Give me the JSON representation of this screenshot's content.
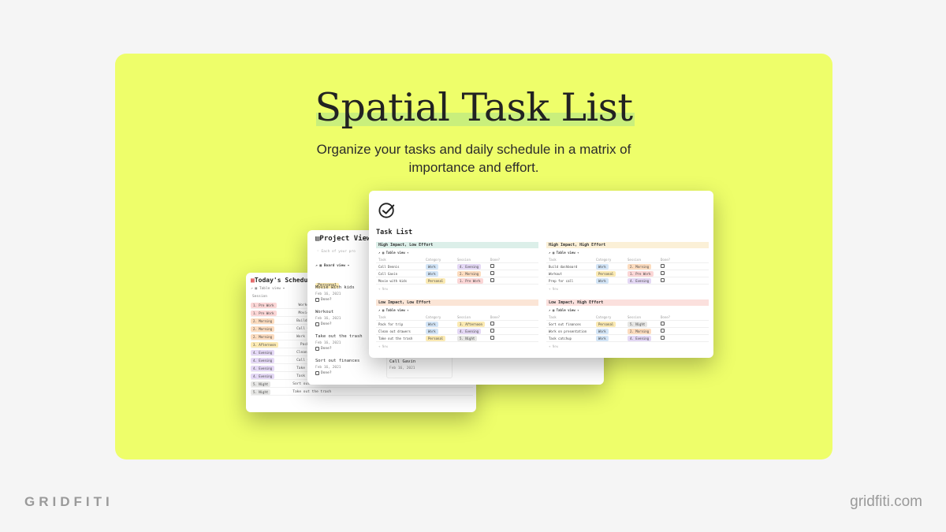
{
  "hero": {
    "title": "Spatial Task List",
    "subtitle": "Organize your tasks and daily schedule in a matrix of importance and effort."
  },
  "schedule_card": {
    "title": "Today's Schedule",
    "view": "Table view",
    "col_session": "Session",
    "rows": [
      {
        "session": "1. Pre Work",
        "color": "red",
        "task": "Workout"
      },
      {
        "session": "1. Pre Work",
        "color": "red",
        "task": "Movie with kids"
      },
      {
        "session": "2. Morning",
        "color": "orange",
        "task": "Build dashboard"
      },
      {
        "session": "2. Morning",
        "color": "orange",
        "task": "Call Gavin"
      },
      {
        "session": "2. Morning",
        "color": "orange",
        "task": "Work on presentation"
      },
      {
        "session": "3. Afternoon",
        "color": "yellow",
        "task": "Pack for trip"
      },
      {
        "session": "4. Evening",
        "color": "purple",
        "task": "Clean out drawers"
      },
      {
        "session": "4. Evening",
        "color": "purple",
        "task": "Call Gavin"
      },
      {
        "session": "4. Evening",
        "color": "purple",
        "task": "Take out the trash"
      },
      {
        "session": "4. Evening",
        "color": "purple",
        "task": "Task catchup"
      },
      {
        "session": "5. Night",
        "color": "gray",
        "task": "Sort out finances"
      },
      {
        "session": "5. Night",
        "color": "gray",
        "task": "Take out the trash"
      }
    ]
  },
  "project_card": {
    "title": "Project View",
    "subtitle": "Each of your pro",
    "view": "Board view",
    "group": "Personal",
    "items": [
      {
        "name": "Movie with kids",
        "date": "Feb 16, 2021",
        "done": "Done?"
      },
      {
        "name": "Workout",
        "date": "Feb 16, 2021",
        "done": "Done?"
      },
      {
        "name": "Take out the trash",
        "date": "Feb 16, 2021",
        "done": "Done?"
      },
      {
        "name": "Sort out finances",
        "date": "Feb 16, 2021",
        "done": "Done?"
      }
    ],
    "side_item": {
      "name": "Call Gavin",
      "date": "Feb 16, 2021"
    }
  },
  "task_card": {
    "title": "Task List",
    "columns": [
      "Task",
      "Category",
      "Session",
      "Done?"
    ],
    "view": "Table view",
    "new_label": "+ New",
    "quadrants": [
      {
        "title": "High Impact, Low Effort",
        "rows": [
          {
            "task": "Call Dennis",
            "category": "Work",
            "cat_color": "blue",
            "session": "4. Evening",
            "ses_color": "purple"
          },
          {
            "task": "Call Gavin",
            "category": "Work",
            "cat_color": "blue",
            "session": "2. Morning",
            "ses_color": "orange"
          },
          {
            "task": "Movie with kids",
            "category": "Personal",
            "cat_color": "yellow",
            "session": "1. Pre Work",
            "ses_color": "red"
          }
        ]
      },
      {
        "title": "High Impact, High Effort",
        "rows": [
          {
            "task": "Build dashboard",
            "category": "Work",
            "cat_color": "blue",
            "session": "2. Morning",
            "ses_color": "orange"
          },
          {
            "task": "Workout",
            "category": "Personal",
            "cat_color": "yellow",
            "session": "1. Pre Work",
            "ses_color": "red"
          },
          {
            "task": "Prep for call",
            "category": "Work",
            "cat_color": "blue",
            "session": "4. Evening",
            "ses_color": "purple"
          }
        ]
      },
      {
        "title": "Low Impact, Low Effort",
        "rows": [
          {
            "task": "Pack for trip",
            "category": "Work",
            "cat_color": "blue",
            "session": "3. Afternoon",
            "ses_color": "yellow"
          },
          {
            "task": "Clean out drawers",
            "category": "Work",
            "cat_color": "blue",
            "session": "4. Evening",
            "ses_color": "purple"
          },
          {
            "task": "Take out the trash",
            "category": "Personal",
            "cat_color": "yellow",
            "session": "5. Night",
            "ses_color": "gray"
          }
        ]
      },
      {
        "title": "Low Impact, High Effort",
        "rows": [
          {
            "task": "Sort out finances",
            "category": "Personal",
            "cat_color": "yellow",
            "session": "5. Night",
            "ses_color": "gray"
          },
          {
            "task": "Work on presentation",
            "category": "Work",
            "cat_color": "blue",
            "session": "2. Morning",
            "ses_color": "orange"
          },
          {
            "task": "Task catchup",
            "category": "Work",
            "cat_color": "blue",
            "session": "4. Evening",
            "ses_color": "purple"
          }
        ]
      }
    ]
  },
  "branding": {
    "left": "GRIDFITI",
    "right": "gridfiti.com"
  },
  "colors": {
    "banner": "#eefe6a",
    "title_highlight": "#c9ef7c",
    "background": "#f5f5f5"
  }
}
